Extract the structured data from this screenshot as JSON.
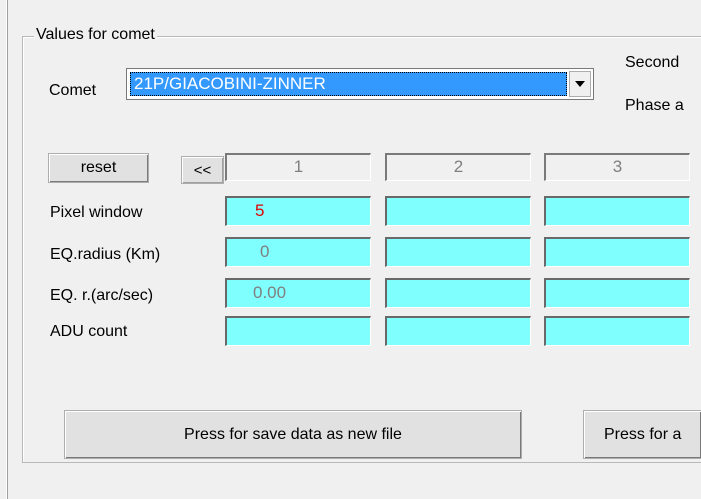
{
  "group": {
    "title": "Values for comet"
  },
  "comet": {
    "label": "Comet",
    "selected": "21P/GIACOBINI-ZINNER"
  },
  "right_labels": {
    "second": "Second",
    "phase": "Phase a"
  },
  "table": {
    "reset_label": "reset",
    "prev_label": "<<",
    "columns": [
      "1",
      "2",
      "3"
    ],
    "rows": [
      {
        "label": "Pixel window",
        "values": [
          "5",
          "",
          ""
        ]
      },
      {
        "label": "EQ.radius (Km)",
        "values": [
          "0",
          "",
          ""
        ]
      },
      {
        "label": "EQ. r.(arc/sec)",
        "values": [
          "0.00",
          "",
          ""
        ]
      },
      {
        "label": "ADU count",
        "values": [
          "",
          "",
          ""
        ]
      }
    ]
  },
  "buttons": {
    "save_new": "Press for save data as new file",
    "save_append": "Press for a"
  },
  "colors": {
    "cell_bg": "#80ffff",
    "selection_bg": "#3399ff",
    "pixel_value": "#e00000"
  }
}
